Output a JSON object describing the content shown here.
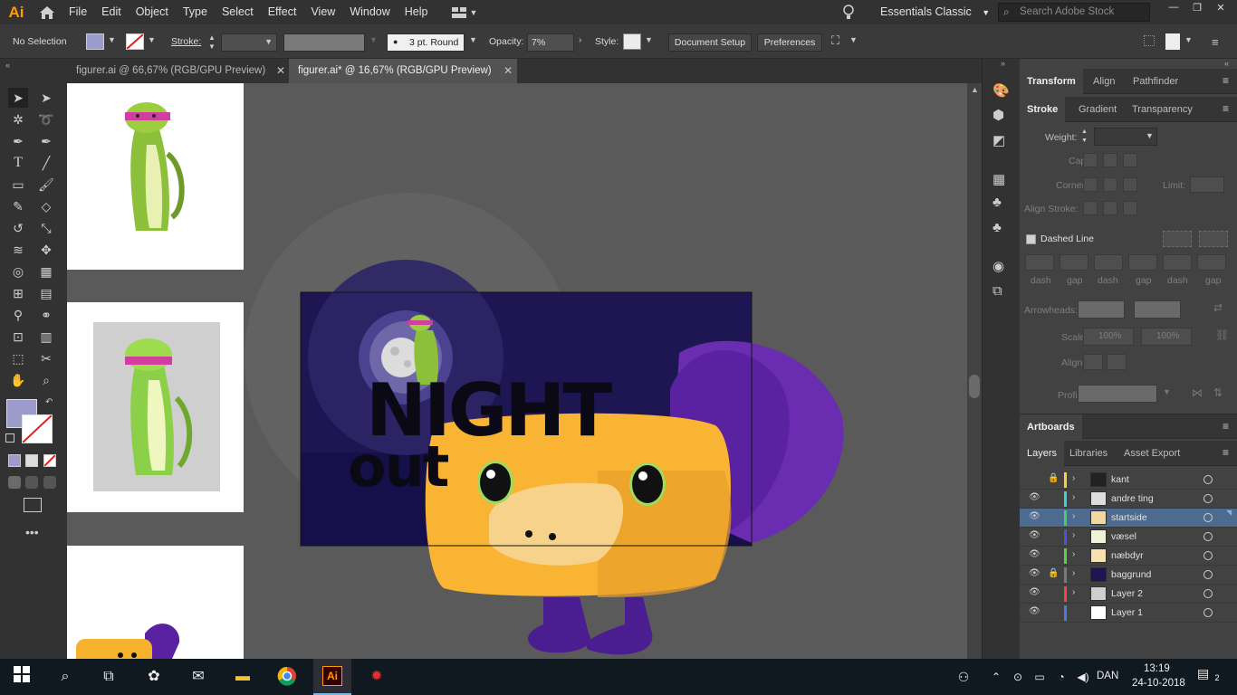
{
  "app": {
    "logo": "Ai",
    "menu": [
      "File",
      "Edit",
      "Object",
      "Type",
      "Select",
      "Effect",
      "View",
      "Window",
      "Help"
    ],
    "workspace": "Essentials Classic",
    "search_placeholder": "Search Adobe Stock"
  },
  "control_bar": {
    "selection": "No Selection",
    "stroke_label": "Stroke:",
    "brush": "3 pt. Round",
    "opacity_label": "Opacity:",
    "opacity_value": "7%",
    "style_label": "Style:",
    "document_setup": "Document Setup",
    "preferences": "Preferences"
  },
  "tabs": [
    {
      "label": "figurer.ai @ 66,67% (RGB/GPU Preview)",
      "close": "✕"
    },
    {
      "label": "figurer.ai* @ 16,67% (RGB/GPU Preview)",
      "close": "✕"
    }
  ],
  "artwork": {
    "line1": "NIGHT",
    "line2": "out"
  },
  "panels": {
    "tabs_top": [
      "Transform",
      "Align",
      "Pathfinder"
    ],
    "tabs_stroke": [
      "Stroke",
      "Gradient",
      "Transparency"
    ],
    "stroke": {
      "weight": "Weight:",
      "cap": "Cap:",
      "corner": "Corner:",
      "limit": "Limit:",
      "align_stroke": "Align Stroke:",
      "dashed_line": "Dashed Line",
      "dash_labels": [
        "dash",
        "gap",
        "dash",
        "gap",
        "dash",
        "gap"
      ],
      "arrowheads": "Arrowheads:",
      "scale": "Scale:",
      "scale_value1": "100%",
      "scale_value2": "100%",
      "align": "Align:",
      "profile": "Profile:"
    },
    "artboards_title": "Artboards",
    "tabs_layers": [
      "Layers",
      "Libraries",
      "Asset Export"
    ],
    "layers": [
      {
        "name": "kant",
        "color": "#f2d13c",
        "locked": true,
        "visible": false,
        "selected": false
      },
      {
        "name": "andre ting",
        "color": "#3fd0d8",
        "locked": false,
        "visible": true,
        "selected": false
      },
      {
        "name": "startside",
        "color": "#3fd06a",
        "locked": false,
        "visible": true,
        "selected": true
      },
      {
        "name": "væsel",
        "color": "#4a54d8",
        "locked": false,
        "visible": true,
        "selected": false
      },
      {
        "name": "næbdyr",
        "color": "#5ad046",
        "locked": false,
        "visible": true,
        "selected": false
      },
      {
        "name": "baggrund",
        "color": "#7a7a7a",
        "locked": true,
        "visible": true,
        "selected": false
      },
      {
        "name": "Layer 2",
        "color": "#e84a4a",
        "locked": false,
        "visible": true,
        "selected": false
      },
      {
        "name": "Layer 1",
        "color": "#4a7ae8",
        "locked": false,
        "visible": true,
        "selected": false
      }
    ]
  },
  "taskbar": {
    "time": "13:19",
    "date": "24-10-2018",
    "language": "DAN",
    "notifications": "2"
  }
}
